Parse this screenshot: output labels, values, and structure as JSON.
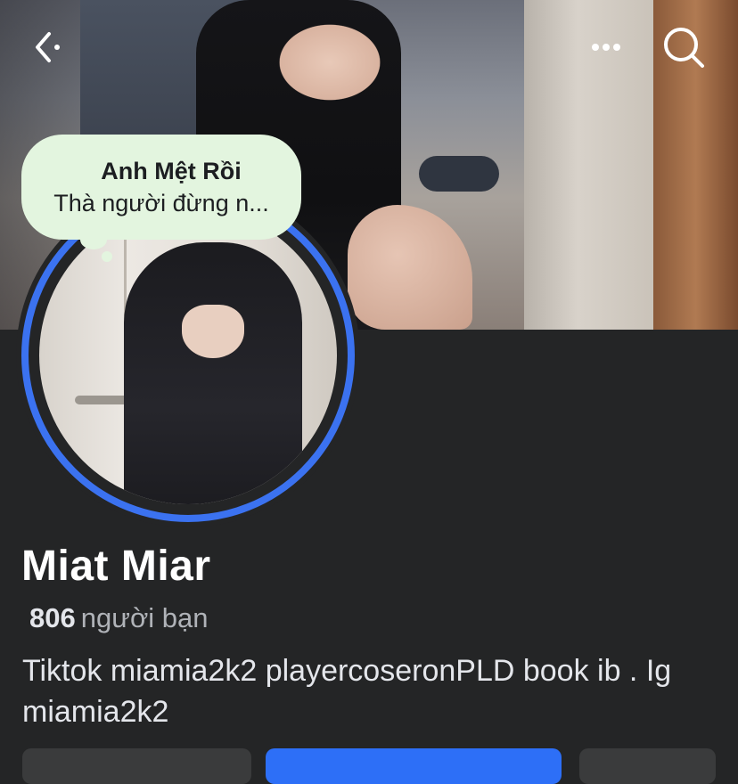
{
  "note": {
    "title": "Anh Mệt Rồi",
    "text": "Thà người đừng n..."
  },
  "profile": {
    "name": "Miat Miar",
    "friends_count": "806",
    "friends_label": "người bạn",
    "bio": "Tiktok miamia2k2 playercoseronPLD book ib . Ig miamia2k2"
  },
  "icons": {
    "back": "chevron-left-icon",
    "more": "more-horizontal-icon",
    "search": "search-icon"
  },
  "colors": {
    "background": "#242526",
    "avatar_ring": "#3b72f0",
    "primary_button": "#2d6ff7",
    "note_bubble": "#e3f5df"
  }
}
